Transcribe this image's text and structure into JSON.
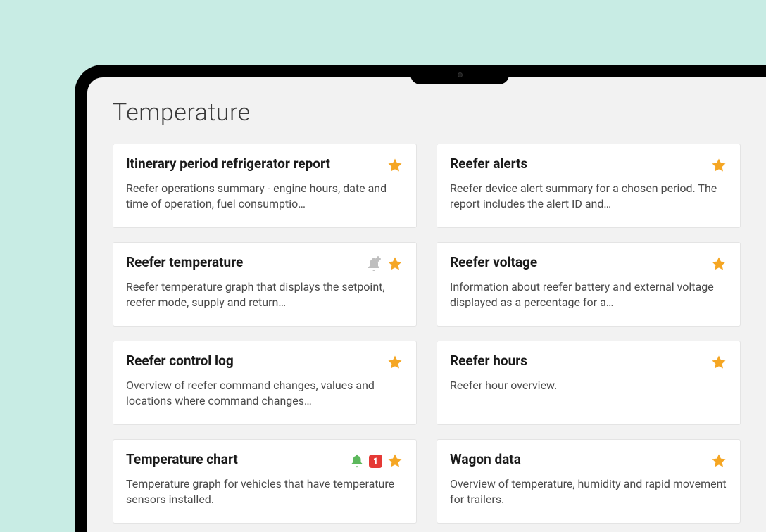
{
  "page": {
    "title": "Temperature"
  },
  "cards": [
    {
      "title": "Itinerary period refrigerator report",
      "desc": "Reefer operations summary - engine hours, date and time of operation, fuel consumptio…",
      "starred": true,
      "bell": false,
      "bellAdd": false,
      "badge": null
    },
    {
      "title": "Reefer alerts",
      "desc": "Reefer device alert summary for a chosen period. The report includes the alert ID and…",
      "starred": true,
      "bell": false,
      "bellAdd": false,
      "badge": null
    },
    {
      "title": "Reefer temperature",
      "desc": "Reefer temperature graph that displays the setpoint, reefer mode, supply and return…",
      "starred": true,
      "bell": false,
      "bellAdd": true,
      "badge": null
    },
    {
      "title": "Reefer voltage",
      "desc": "Information about reefer battery and external voltage displayed as a percentage for a…",
      "starred": true,
      "bell": false,
      "bellAdd": false,
      "badge": null
    },
    {
      "title": "Reefer control log",
      "desc": "Overview of reefer command changes, values and locations where command changes…",
      "starred": true,
      "bell": false,
      "bellAdd": false,
      "badge": null
    },
    {
      "title": "Reefer hours",
      "desc": "Reefer hour overview.",
      "starred": true,
      "bell": false,
      "bellAdd": false,
      "badge": null
    },
    {
      "title": "Temperature chart",
      "desc": "Temperature graph for vehicles that have temperature sensors installed.",
      "starred": true,
      "bell": true,
      "bellAdd": false,
      "badge": "1"
    },
    {
      "title": "Wagon data",
      "desc": "Overview of temperature, humidity and rapid movement for trailers.",
      "starred": true,
      "bell": false,
      "bellAdd": false,
      "badge": null
    }
  ]
}
